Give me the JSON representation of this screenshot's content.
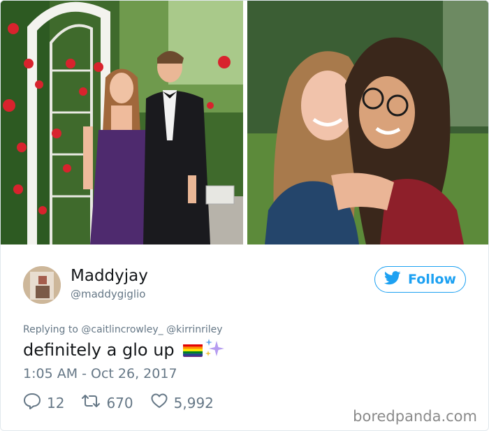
{
  "tweet": {
    "display_name": "Maddyjay",
    "handle": "@maddygiglio",
    "follow_label": "Follow",
    "replying_prefix": "Replying to",
    "mention_1": "@caitlincrowley_",
    "mention_2": "@kirrinriley",
    "text": "definitely a glo up",
    "timestamp": "1:05 AM - Oct 26, 2017",
    "reply_count": "12",
    "retweet_count": "670",
    "like_count": "5,992"
  },
  "watermark": "boredpanda.com",
  "colors": {
    "accent": "#1da1f2",
    "secondary_text": "#657786",
    "primary_text": "#14171a"
  },
  "icons": {
    "follow": "twitter-bird-icon",
    "reply": "reply-bubble-icon",
    "retweet": "retweet-icon",
    "like": "heart-icon",
    "emoji_1": "rainbow-flag-emoji",
    "emoji_2": "sparkles-emoji"
  }
}
